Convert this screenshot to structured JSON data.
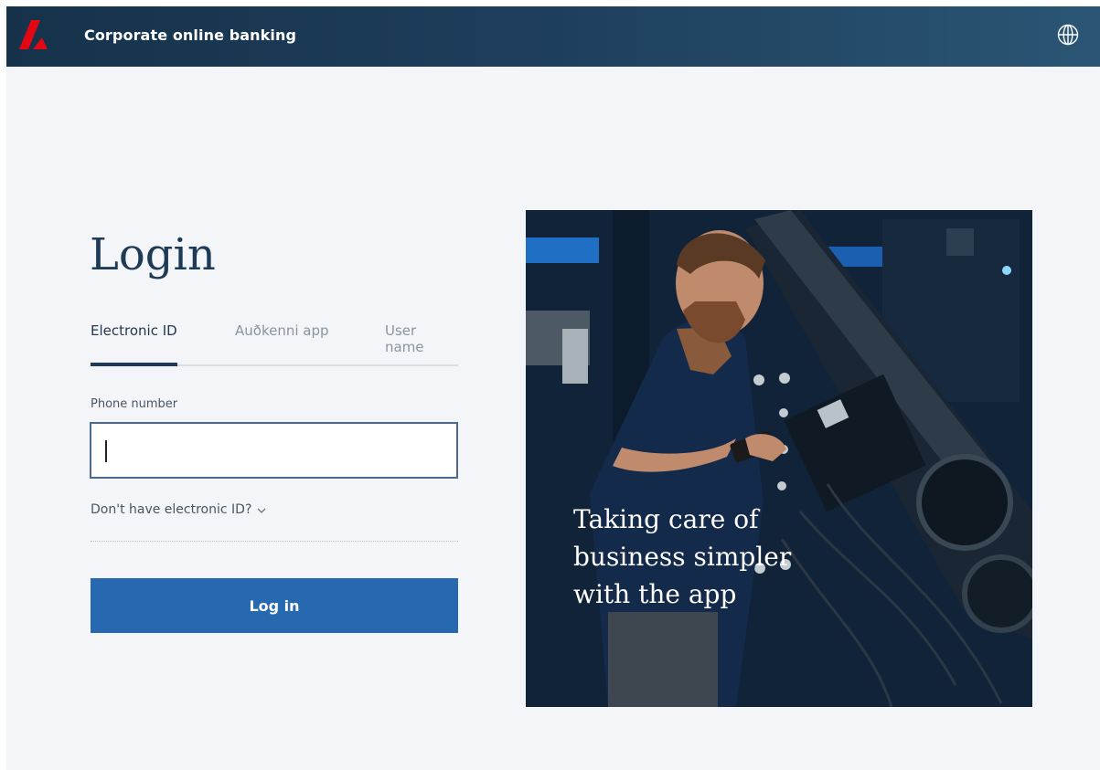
{
  "header": {
    "title": "Corporate online banking",
    "logo_icon": "bank-logo-icon",
    "language_icon": "globe-icon",
    "brand_color": "#e30613"
  },
  "login": {
    "title": "Login",
    "tabs": [
      {
        "label": "Electronic ID",
        "active": true
      },
      {
        "label": "Auðkenni app",
        "active": false
      },
      {
        "label": "User name",
        "active": false
      }
    ],
    "phone": {
      "label": "Phone number",
      "value": "",
      "placeholder": ""
    },
    "no_eid_link": "Don't have electronic ID?",
    "submit_label": "Log in",
    "accent_color": "#2669b0"
  },
  "promo": {
    "text": "Taking care of business simpler with the app"
  }
}
